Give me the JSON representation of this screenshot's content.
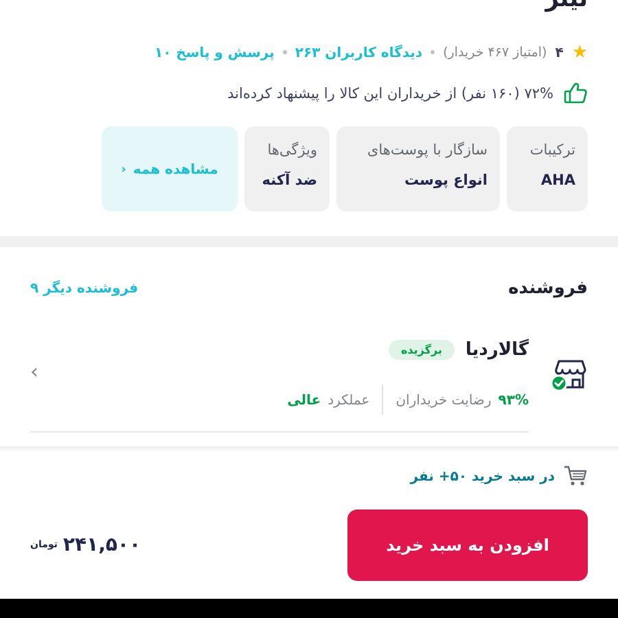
{
  "product": {
    "title_partial": "تیتر",
    "rating": "۴",
    "rating_count": "(امتیاز ۴۶۷ خریدار)",
    "reviews": "۲۶۳ دیدگاه کاربران",
    "qa": "۱۰ پرسش و پاسخ",
    "recommend_text": "۷۲% (۱۶۰ نفر) از خریداران این کالا را پیشنهاد کرده‌اند"
  },
  "attributes": [
    {
      "key": "ترکیبات",
      "value": "AHA"
    },
    {
      "key": "سازگار با پوست‌های",
      "value": "انواع پوست"
    },
    {
      "key": "ویژگی‌ها",
      "value": "ضد آکنه"
    }
  ],
  "see_all_label": "مشاهده همه",
  "seller": {
    "section_title": "فروشنده",
    "other_sellers": "۹ فروشنده دیگر",
    "name": "گالاردیا",
    "badge": "برگزیده",
    "satisfaction_value": "۹۳%",
    "satisfaction_label": "رضایت خریداران",
    "performance_label": "عملکرد",
    "performance_value": "عالی"
  },
  "cart": {
    "in_cart_text": "در سبد خرید ۵۰+ نفر",
    "add_button_label": "افزودن به سبد خرید",
    "price": "۲۴۱,۵۰۰",
    "currency": "تومان"
  },
  "colors": {
    "accent_cyan": "#19bfd3",
    "primary_red": "#e0164c",
    "success_green": "#00a049",
    "star_yellow": "#f9bc00"
  }
}
